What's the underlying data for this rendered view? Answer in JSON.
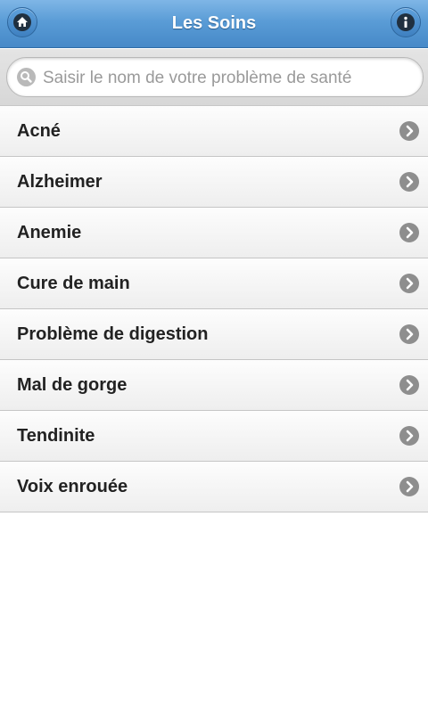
{
  "header": {
    "title": "Les Soins",
    "left_icon": "home-icon",
    "right_icon": "info-icon"
  },
  "search": {
    "placeholder": "Saisir le nom de votre problème de santé",
    "value": ""
  },
  "list": {
    "items": [
      {
        "label": "Acné"
      },
      {
        "label": "Alzheimer"
      },
      {
        "label": "Anemie"
      },
      {
        "label": "Cure de main"
      },
      {
        "label": "Problème de digestion"
      },
      {
        "label": "Mal de gorge"
      },
      {
        "label": "Tendinite"
      },
      {
        "label": "Voix enrouée"
      }
    ],
    "item_icon": "chevron-right-icon"
  },
  "colors": {
    "header": "#5a9cd6",
    "chevron": "#8e8e8e"
  }
}
